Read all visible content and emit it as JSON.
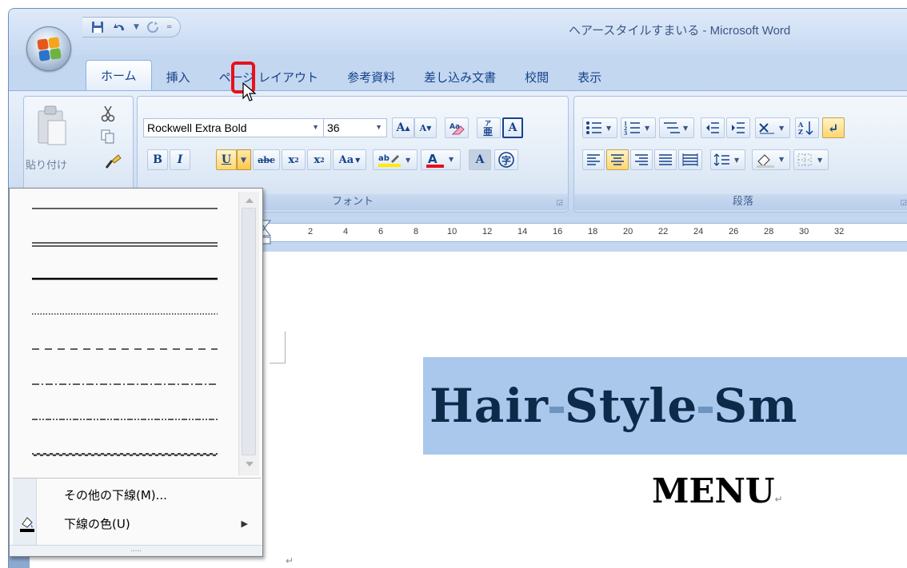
{
  "window": {
    "title": "ヘアースタイルすまいる - Microsoft Word"
  },
  "qat": {
    "save_icon": "save-icon",
    "undo_icon": "undo-icon",
    "redo_icon": "redo-icon",
    "customize": "="
  },
  "tabs": [
    {
      "label": "ホーム",
      "active": true
    },
    {
      "label": "挿入"
    },
    {
      "label": "ページ レイアウト"
    },
    {
      "label": "参考資料"
    },
    {
      "label": "差し込み文書"
    },
    {
      "label": "校閲"
    },
    {
      "label": "表示"
    }
  ],
  "clipboard": {
    "paste_label": "貼り付け"
  },
  "font_group": {
    "label": "フォント",
    "font_name": "Rockwell Extra Bold",
    "font_size": "36",
    "bold": "B",
    "italic": "I",
    "underline": "U",
    "change_case": "Aa"
  },
  "paragraph_group": {
    "label": "段落"
  },
  "ruler": {
    "numbers": [
      "2",
      "4",
      "6",
      "8",
      "10",
      "12",
      "14",
      "16",
      "18",
      "20",
      "22",
      "24",
      "26",
      "28",
      "30",
      "32"
    ]
  },
  "document": {
    "title_word1": "Hair",
    "title_word2": "Style",
    "title_word3": "Sm",
    "menu": "MENU"
  },
  "underline_menu": {
    "styles": [
      "single",
      "double",
      "thick",
      "dotted",
      "dashed",
      "dash-dot",
      "dash-dot-dot",
      "wave"
    ],
    "more_underlines": "その他の下線(M)...",
    "underline_color": "下線の色(U)",
    "grip": "....."
  },
  "colors": {
    "accent_highlight": "#e8101b",
    "selection": "#a9c8ec",
    "title_text": "#0d2a4a"
  }
}
